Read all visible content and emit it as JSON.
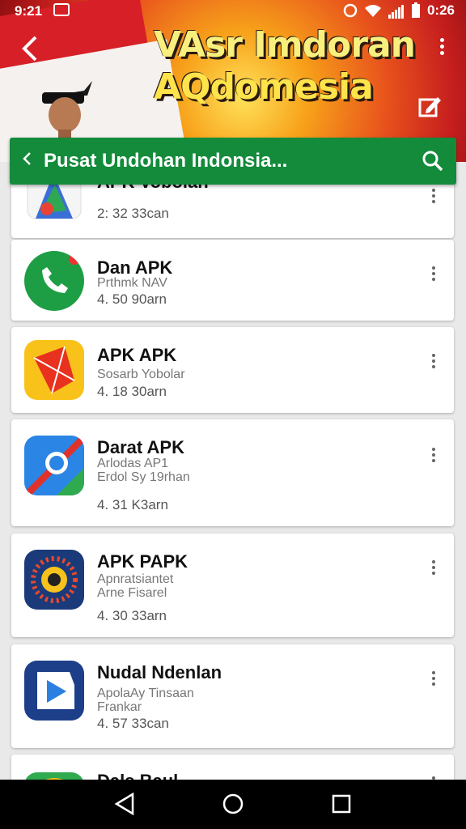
{
  "status_bar": {
    "time": "9:21",
    "battery_time": "0:26"
  },
  "header": {
    "banner_title_line1": "VAsr Imdoran",
    "banner_title_line2": "AQdomesia",
    "search_title": "Pusat Undohan Indonsia..."
  },
  "apps": [
    {
      "name": "APK Vobolan",
      "subtitle": "",
      "meta": "2: 32 33can",
      "icon": "maps-icon"
    },
    {
      "name": "Dan APK",
      "subtitle": "Prthmk NAV",
      "meta": "4. 50 90arn",
      "icon": "phone-icon"
    },
    {
      "name": "APK APK",
      "subtitle": "Sosarb Yobolar",
      "meta": "4. 18 30arn",
      "icon": "kite-icon"
    },
    {
      "name": "Darat APK",
      "subtitle": "Arlodas AP1\nErdol Sy 19rhan",
      "meta": "4. 31 K3arn",
      "icon": "compass-icon"
    },
    {
      "name": "APK PAPK",
      "subtitle": "Apnratsiantet\nArne Fisarel",
      "meta": "4. 30 33arn",
      "icon": "sun-icon"
    },
    {
      "name": "Nudal Ndenlan",
      "subtitle": "ApolaAy Tinsaan\nFrankar",
      "meta": "4. 57 33can",
      "icon": "play-icon"
    },
    {
      "name": "Dals Baul",
      "subtitle": "",
      "meta": "",
      "icon": "chrome-icon"
    }
  ],
  "colors": {
    "accent_green": "#138b3b",
    "banner_red": "#c71f1e",
    "banner_yellow": "#ffe25a"
  }
}
